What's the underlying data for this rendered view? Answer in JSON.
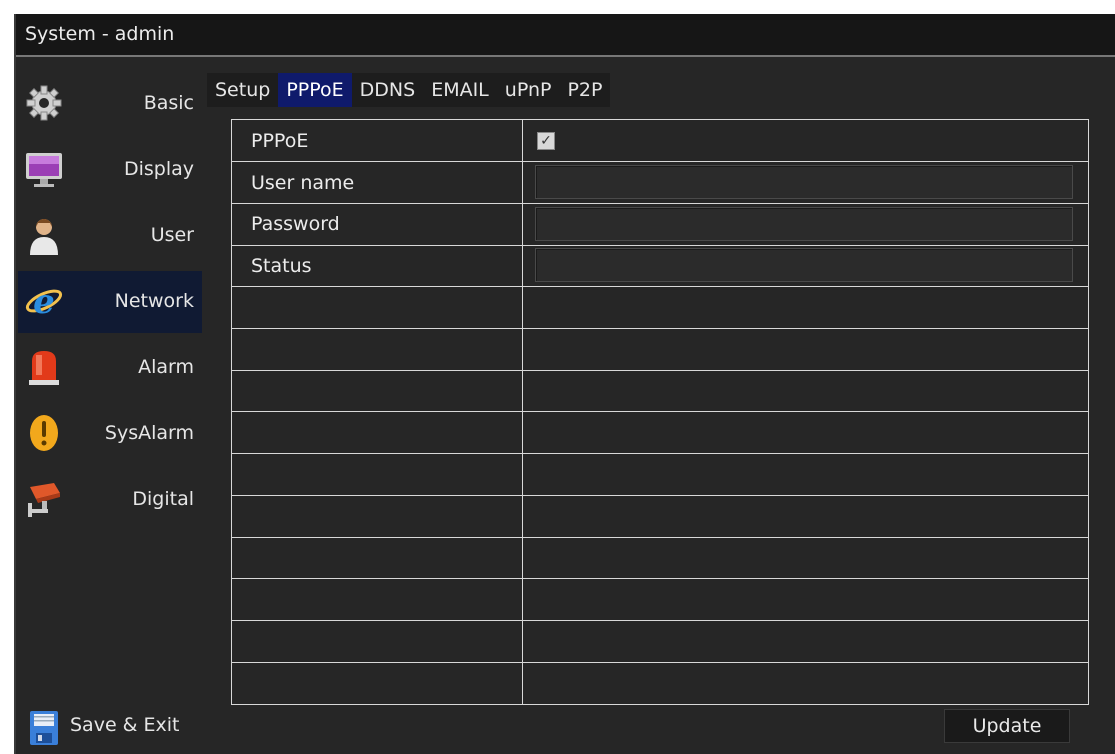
{
  "window": {
    "title": "System - admin"
  },
  "sidebar": {
    "items": [
      {
        "label": "Basic",
        "icon": "gear-icon"
      },
      {
        "label": "Display",
        "icon": "monitor-icon"
      },
      {
        "label": "User",
        "icon": "user-icon"
      },
      {
        "label": "Network",
        "icon": "network-icon",
        "active": true
      },
      {
        "label": "Alarm",
        "icon": "alarm-light-icon"
      },
      {
        "label": "SysAlarm",
        "icon": "warning-icon"
      },
      {
        "label": "Digital",
        "icon": "camera-icon"
      }
    ],
    "save_exit": {
      "label": "Save & Exit",
      "icon": "floppy-disk-icon"
    }
  },
  "tabs": [
    {
      "label": "Setup"
    },
    {
      "label": "PPPoE",
      "active": true
    },
    {
      "label": "DDNS"
    },
    {
      "label": "EMAIL"
    },
    {
      "label": "uPnP"
    },
    {
      "label": "P2P"
    }
  ],
  "form": {
    "pppoe_label": "PPPoE",
    "pppoe_checked": true,
    "username_label": "User name",
    "username_value": "",
    "password_label": "Password",
    "password_value": "",
    "status_label": "Status",
    "status_value": ""
  },
  "buttons": {
    "update": "Update"
  },
  "colors": {
    "background": "#262626",
    "active_tab": "#0f1a6b",
    "active_sidebar": "#101a33",
    "grid_line": "#d8d8d8"
  }
}
